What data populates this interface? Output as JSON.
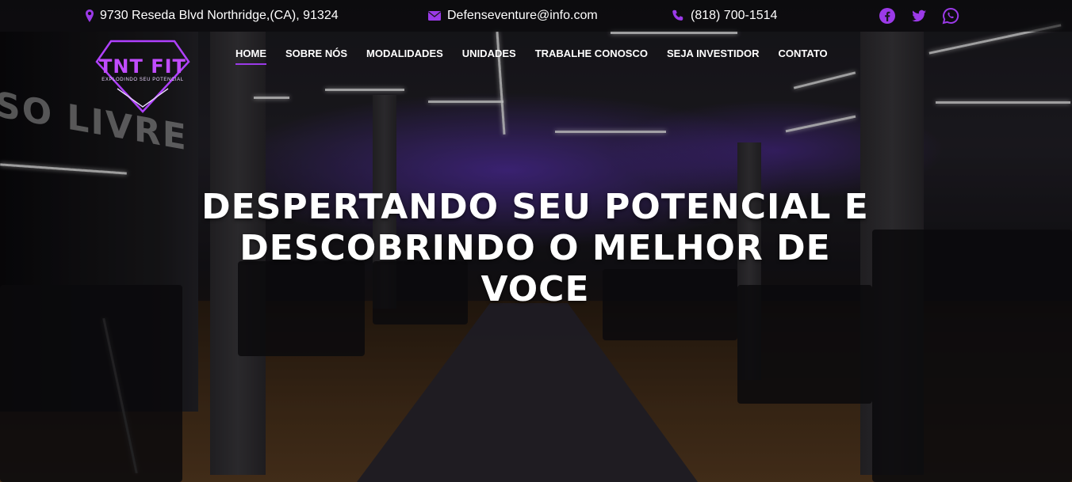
{
  "topbar": {
    "address": "9730 Reseda Blvd Northridge,(CA), 91324",
    "email": "Defenseventure@info.com",
    "phone": "(818) 700-1514",
    "address_icon": "map-pin-icon",
    "email_icon": "envelope-icon",
    "phone_icon": "phone-icon",
    "social": [
      "facebook-icon",
      "twitter-icon",
      "whatsapp-icon"
    ],
    "accent_color": "#9b3ae8"
  },
  "logo": {
    "title": "TNT FIT",
    "tagline": "EXPLODINDO SEU POTENCIAL"
  },
  "nav": {
    "items": [
      "HOME",
      "SOBRE NÓS",
      "MODALIDADES",
      "UNIDADES",
      "TRABALHE CONOSCO",
      "SEJA INVESTIDOR",
      "CONTATO"
    ],
    "active": "HOME"
  },
  "background": {
    "wall_text": "SO LIVRE"
  },
  "hero": {
    "headline_line1": "DESPERTANDO SEU POTENCIAL E",
    "headline_line2": "DESCOBRINDO O MELHOR DE",
    "headline_line3": "VOCE"
  }
}
